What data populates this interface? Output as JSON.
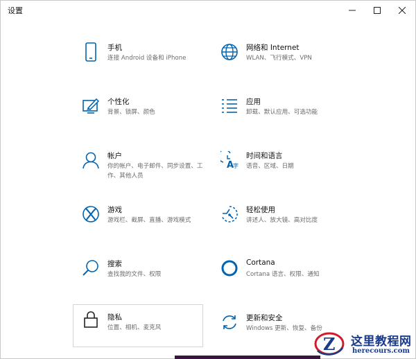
{
  "window": {
    "title": "设置",
    "minimize": "—",
    "close": "✕"
  },
  "tiles": [
    {
      "title": "手机",
      "desc": "连接 Android 设备和 iPhone",
      "icon": "phone-icon"
    },
    {
      "title": "网络和 Internet",
      "desc": "WLAN、飞行模式、VPN",
      "icon": "globe-icon"
    },
    {
      "title": "个性化",
      "desc": "背景、锁屏、颜色",
      "icon": "personalization-icon"
    },
    {
      "title": "应用",
      "desc": "卸载、默认应用、可选功能",
      "icon": "apps-list-icon"
    },
    {
      "title": "帐户",
      "desc": "你的帐户、电子邮件、同步设置、工作、其他人员",
      "icon": "account-icon"
    },
    {
      "title": "时间和语言",
      "desc": "语音、区域、日期",
      "icon": "time-language-icon"
    },
    {
      "title": "游戏",
      "desc": "游戏栏、截屏、直播、游戏模式",
      "icon": "xbox-icon"
    },
    {
      "title": "轻松使用",
      "desc": "讲述人、放大镜、高对比度",
      "icon": "ease-of-access-icon"
    },
    {
      "title": "搜索",
      "desc": "查找我的文件、权限",
      "icon": "search-icon"
    },
    {
      "title": "Cortana",
      "desc": "Cortana 语言、权限、通知",
      "icon": "cortana-icon"
    },
    {
      "title": "隐私",
      "desc": "位置、相机、麦克风",
      "icon": "lock-icon"
    },
    {
      "title": "更新和安全",
      "desc": "Windows 更新、恢复、备份",
      "icon": "update-sync-icon"
    }
  ],
  "watermark": {
    "title": "这里教程网",
    "url": "herecours.com",
    "logo_letter": "Z"
  },
  "colors": {
    "accent": "#0063b1",
    "watermark": "#1a3a8c",
    "logo_red": "#d11a2a"
  }
}
